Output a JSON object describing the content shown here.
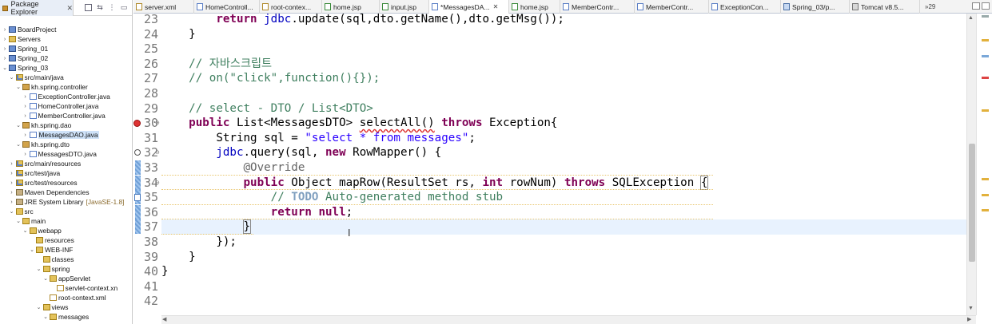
{
  "explorer": {
    "title": "Package Explorer",
    "close": "✕",
    "tree": [
      {
        "label": "BoardProject",
        "icon": "project-icon",
        "arrow": "›",
        "depth": 0
      },
      {
        "label": "Servers",
        "icon": "folder-icon",
        "arrow": "›",
        "depth": 0
      },
      {
        "label": "Spring_01",
        "icon": "project-icon",
        "arrow": "›",
        "depth": 0
      },
      {
        "label": "Spring_02",
        "icon": "project-icon",
        "arrow": "›",
        "depth": 0
      },
      {
        "label": "Spring_03",
        "icon": "project-icon",
        "arrow": "⌄",
        "depth": 0
      },
      {
        "label": "src/main/java",
        "icon": "source-folder-icon",
        "arrow": "⌄",
        "depth": 1
      },
      {
        "label": "kh.spring.controller",
        "icon": "package-icon",
        "arrow": "⌄",
        "depth": 2
      },
      {
        "label": "ExceptionController.java",
        "icon": "java-file-icon",
        "arrow": "›",
        "depth": 3
      },
      {
        "label": "HomeController.java",
        "icon": "java-file-icon",
        "arrow": "›",
        "depth": 3
      },
      {
        "label": "MemberController.java",
        "icon": "java-file-icon",
        "arrow": "›",
        "depth": 3
      },
      {
        "label": "kh.spring.dao",
        "icon": "package-icon",
        "arrow": "⌄",
        "depth": 2
      },
      {
        "label": "MessagesDAO.java",
        "icon": "java-file-icon",
        "arrow": "›",
        "depth": 3,
        "selected": true
      },
      {
        "label": "kh.spring.dto",
        "icon": "package-icon",
        "arrow": "⌄",
        "depth": 2
      },
      {
        "label": "MessagesDTO.java",
        "icon": "java-file-icon",
        "arrow": "›",
        "depth": 3
      },
      {
        "label": "src/main/resources",
        "icon": "source-folder-icon",
        "arrow": "›",
        "depth": 1
      },
      {
        "label": "src/test/java",
        "icon": "source-folder-icon",
        "arrow": "›",
        "depth": 1
      },
      {
        "label": "src/test/resources",
        "icon": "source-folder-icon",
        "arrow": "›",
        "depth": 1
      },
      {
        "label": "Maven Dependencies",
        "icon": "library-icon",
        "arrow": "›",
        "depth": 1
      },
      {
        "label": "JRE System Library",
        "extra": "[JavaSE-1.8]",
        "icon": "library-icon",
        "arrow": "›",
        "depth": 1
      },
      {
        "label": "src",
        "icon": "folder-icon",
        "arrow": "⌄",
        "depth": 1
      },
      {
        "label": "main",
        "icon": "folder-icon",
        "arrow": "⌄",
        "depth": 2
      },
      {
        "label": "webapp",
        "icon": "folder-icon",
        "arrow": "⌄",
        "depth": 3
      },
      {
        "label": "resources",
        "icon": "folder-icon",
        "arrow": "",
        "depth": 4
      },
      {
        "label": "WEB-INF",
        "icon": "folder-icon",
        "arrow": "⌄",
        "depth": 4
      },
      {
        "label": "classes",
        "icon": "folder-icon",
        "arrow": "",
        "depth": 5
      },
      {
        "label": "spring",
        "icon": "folder-icon",
        "arrow": "⌄",
        "depth": 5
      },
      {
        "label": "appServlet",
        "icon": "folder-icon",
        "arrow": "⌄",
        "depth": 6
      },
      {
        "label": "servlet-context.xn",
        "icon": "xml-file-icon",
        "arrow": "",
        "depth": 7
      },
      {
        "label": "root-context.xml",
        "icon": "xml-file-icon",
        "arrow": "",
        "depth": 6
      },
      {
        "label": "views",
        "icon": "folder-icon",
        "arrow": "⌄",
        "depth": 5
      },
      {
        "label": "messages",
        "icon": "folder-icon",
        "arrow": "⌄",
        "depth": 6
      }
    ]
  },
  "tabs": [
    {
      "label": "server.xml",
      "icon": "xml"
    },
    {
      "label": "HomeControll...",
      "icon": "java"
    },
    {
      "label": "root-contex...",
      "icon": "xml"
    },
    {
      "label": "home.jsp",
      "icon": "jsp"
    },
    {
      "label": "input.jsp",
      "icon": "jsp"
    },
    {
      "label": "*MessagesDA...",
      "icon": "java",
      "active": true,
      "close": "✕"
    },
    {
      "label": "home.jsp",
      "icon": "jsp"
    },
    {
      "label": "MemberContr...",
      "icon": "java"
    },
    {
      "label": "MemberContr...",
      "icon": "java"
    },
    {
      "label": "ExceptionCon...",
      "icon": "java"
    },
    {
      "label": "Spring_03/p...",
      "icon": "web"
    },
    {
      "label": "Tomcat v8.5...",
      "icon": "srv"
    }
  ],
  "tab_overflow": "»29",
  "editor": {
    "lines": [
      {
        "n": "23",
        "html": "        <span class='kw'>return</span> <span class='fld'>jdbc</span>.update(sql,dto.getName(),dto.getMsg());"
      },
      {
        "n": "24",
        "html": "    }"
      },
      {
        "n": "25",
        "html": ""
      },
      {
        "n": "26",
        "html": "    <span class='cmt'>// 자바스크립트</span>"
      },
      {
        "n": "27",
        "html": "    <span class='cmt'>// on(\"click\",function(){});</span>"
      },
      {
        "n": "28",
        "html": ""
      },
      {
        "n": "29",
        "html": "    <span class='cmt'>// select - DTO / List&lt;DTO&gt;</span>"
      },
      {
        "n": "30",
        "html": "    <span class='kw'>public</span> List&lt;MessagesDTO&gt; <span class='err'>selectAll()</span> <span class='kw'>throws</span> Exception{"
      },
      {
        "n": "31",
        "html": "        String sql = <span class='str'>\"select * from messages\"</span>;"
      },
      {
        "n": "32",
        "html": "        <span class='fld'>jdbc</span>.query(sql, <span class='kw'>new</span> RowMapper() {"
      },
      {
        "n": "33",
        "html": "            <span class='ann'>@Override</span>"
      },
      {
        "n": "34",
        "html": "            <span class='kw'>public</span> Object mapRow(ResultSet rs, <span class='kw'>int</span> rowNum) <span class='kw'>throws</span> SQLException <span style='outline:1px solid #888'>{</span>"
      },
      {
        "n": "35",
        "html": "                <span class='cmt'>// <span class='todo'>TODO</span> Auto-generated method stub</span>"
      },
      {
        "n": "36",
        "html": "                <span class='kw'>return</span> <span class='kw'>null</span>;"
      },
      {
        "n": "37",
        "html": "            <span style='outline:1px solid #888'>}</span><span class='caret'></span>"
      },
      {
        "n": "38",
        "html": "        });"
      },
      {
        "n": "39",
        "html": "    }"
      },
      {
        "n": "40",
        "html": "}"
      },
      {
        "n": "41",
        "html": ""
      },
      {
        "n": "42",
        "html": ""
      }
    ],
    "current_line": "37"
  },
  "colors": {
    "keyword": "#7f0055",
    "string": "#2a00ff",
    "comment": "#3f7f5f",
    "field": "#0000c0",
    "current_line_bg": "#e8f2fe"
  }
}
